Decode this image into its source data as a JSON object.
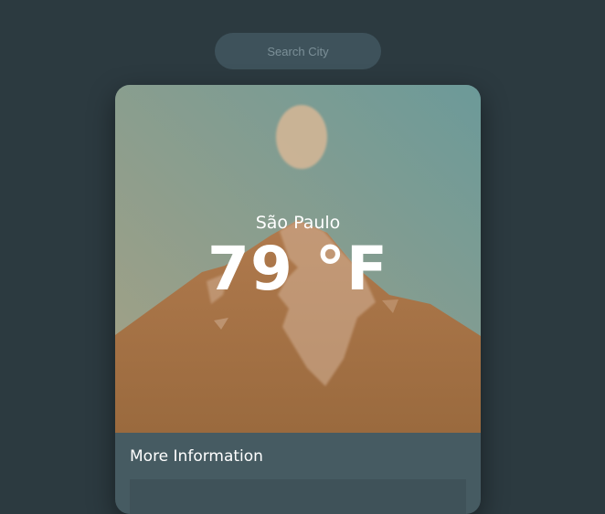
{
  "search": {
    "placeholder": "Search City"
  },
  "weather": {
    "city": "São Paulo",
    "temperature": "79 °F"
  },
  "more_info": {
    "title": "More Information"
  },
  "colors": {
    "background": "#2c3a40",
    "card": "#465b62",
    "sky_top": "#6e9a98",
    "sky_bottom": "#a49e84",
    "mountain": "#a8744a",
    "sun": "#d2b696"
  },
  "icons": [
    "sun-icon",
    "mountain-icon"
  ]
}
